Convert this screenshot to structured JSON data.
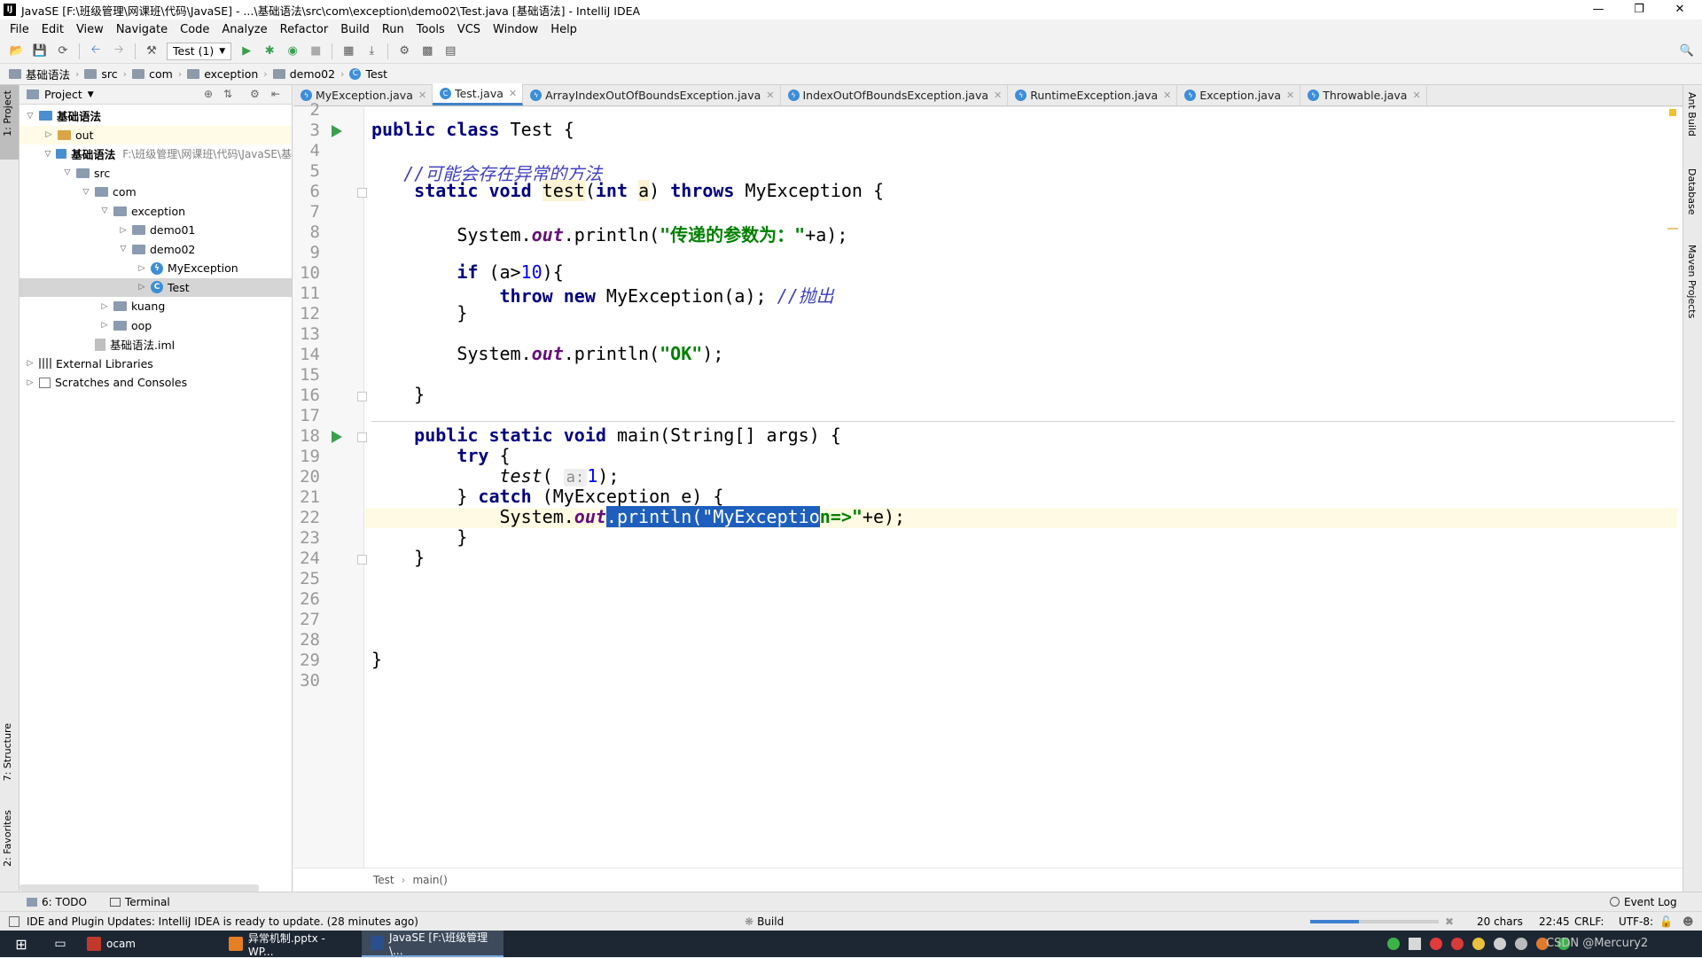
{
  "window": {
    "title": "JavaSE [F:\\班级管理\\网课班\\代码\\JavaSE] - ...\\基础语法\\src\\com\\exception\\demo02\\Test.java [基础语法] - IntelliJ IDEA",
    "app_icon": "IJ"
  },
  "menu": [
    "File",
    "Edit",
    "View",
    "Navigate",
    "Code",
    "Analyze",
    "Refactor",
    "Build",
    "Run",
    "Tools",
    "VCS",
    "Window",
    "Help"
  ],
  "toolbar": {
    "run_config": "Test (1)"
  },
  "breadcrumbs": [
    "基础语法",
    "src",
    "com",
    "exception",
    "demo02",
    "Test"
  ],
  "side_tools": {
    "project": "1: Project",
    "structure": "7: Structure",
    "favorites": "2: Favorites",
    "ant": "Ant Build",
    "database": "Database",
    "maven": "Maven Projects"
  },
  "project_panel": {
    "title": "Project",
    "tree": [
      {
        "label": "基础语法",
        "kind": "module",
        "depth": 0,
        "expanded": true,
        "path": ""
      },
      {
        "label": "out",
        "kind": "out",
        "depth": 1,
        "expanded": false,
        "path": ""
      },
      {
        "label": "基础语法",
        "kind": "module",
        "depth": 1,
        "expanded": true,
        "path": "F:\\班级管理\\网课班\\代码\\JavaSE\\基"
      },
      {
        "label": "src",
        "kind": "folder",
        "depth": 2,
        "expanded": true,
        "path": ""
      },
      {
        "label": "com",
        "kind": "folder",
        "depth": 3,
        "expanded": true,
        "path": ""
      },
      {
        "label": "exception",
        "kind": "folder",
        "depth": 4,
        "expanded": true,
        "path": ""
      },
      {
        "label": "demo01",
        "kind": "folder",
        "depth": 5,
        "expanded": false,
        "path": ""
      },
      {
        "label": "demo02",
        "kind": "folder",
        "depth": 5,
        "expanded": true,
        "path": ""
      },
      {
        "label": "MyException",
        "kind": "exception-class",
        "depth": 6,
        "expanded": false,
        "path": ""
      },
      {
        "label": "Test",
        "kind": "class",
        "depth": 6,
        "expanded": false,
        "path": ""
      },
      {
        "label": "kuang",
        "kind": "folder",
        "depth": 4,
        "expanded": false,
        "path": ""
      },
      {
        "label": "oop",
        "kind": "folder",
        "depth": 4,
        "expanded": false,
        "path": ""
      },
      {
        "label": "基础语法.iml",
        "kind": "iml",
        "depth": 3,
        "expanded": null,
        "path": ""
      },
      {
        "label": "External Libraries",
        "kind": "library",
        "depth": 0,
        "expanded": false,
        "path": ""
      },
      {
        "label": "Scratches and Consoles",
        "kind": "scratch",
        "depth": 0,
        "expanded": false,
        "path": ""
      }
    ]
  },
  "tabs": [
    {
      "label": "MyException.java",
      "active": false
    },
    {
      "label": "Test.java",
      "active": true
    },
    {
      "label": "ArrayIndexOutOfBoundsException.java",
      "active": false
    },
    {
      "label": "IndexOutOfBoundsException.java",
      "active": false
    },
    {
      "label": "RuntimeException.java",
      "active": false
    },
    {
      "label": "Exception.java",
      "active": false
    },
    {
      "label": "Throwable.java",
      "active": false
    }
  ],
  "editor": {
    "line_numbers": [
      "2",
      "3",
      "4",
      "5",
      "6",
      "7",
      "8",
      "9",
      "10",
      "11",
      "12",
      "13",
      "14",
      "15",
      "16",
      "17",
      "18",
      "19",
      "20",
      "21",
      "22",
      "23",
      "24",
      "25",
      "26",
      "27",
      "28",
      "29",
      "30"
    ],
    "code": {
      "l3": [
        "public class ",
        "Test {"
      ],
      "l5": "//可能会存在异常的方法",
      "l6": [
        "static void ",
        "test",
        "(",
        "int ",
        "a",
        ") ",
        "throws ",
        "MyException {"
      ],
      "l8": [
        "System.",
        "out",
        ".println(",
        "\"传递的参数为：\"",
        "+a);"
      ],
      "l10": [
        "if ",
        "(a>",
        "10",
        "){"
      ],
      "l11": [
        "throw new ",
        "MyException(a); ",
        "//抛出"
      ],
      "l12": "}",
      "l14": [
        "System.",
        "out",
        ".println(",
        "\"OK\"",
        ");"
      ],
      "l16": "}",
      "l18": [
        "public static void ",
        "main(String[] args) {"
      ],
      "l19": [
        "try ",
        "{"
      ],
      "l20": [
        "test",
        "(",
        "a:",
        "1",
        ");"
      ],
      "l21": [
        "} ",
        "catch ",
        "(MyException e) {"
      ],
      "l22": [
        "System.",
        "out",
        ".println(\"MyExceptio",
        "n=>\"",
        "+e);"
      ],
      "l23": "}",
      "l24": "}",
      "l29": "}"
    },
    "breadcrumb": [
      "Test",
      "main()"
    ]
  },
  "bottom_tools": {
    "todo": "6: TODO",
    "terminal": "Terminal",
    "event_log": "Event Log"
  },
  "status": {
    "message": "IDE and Plugin Updates: IntelliJ IDEA is ready to update. (28 minutes ago)",
    "build": "Build",
    "chars": "20 chars",
    "position": "22:45",
    "line_sep": "CRLF:",
    "encoding": "UTF-8:"
  },
  "taskbar": {
    "items": [
      {
        "label": "ocam",
        "active": false
      },
      {
        "label": "异常机制.pptx - WP...",
        "active": false
      },
      {
        "label": "JavaSE [F:\\班级管理\\...",
        "active": true
      }
    ],
    "watermark": "CSDN @Mercury2"
  }
}
